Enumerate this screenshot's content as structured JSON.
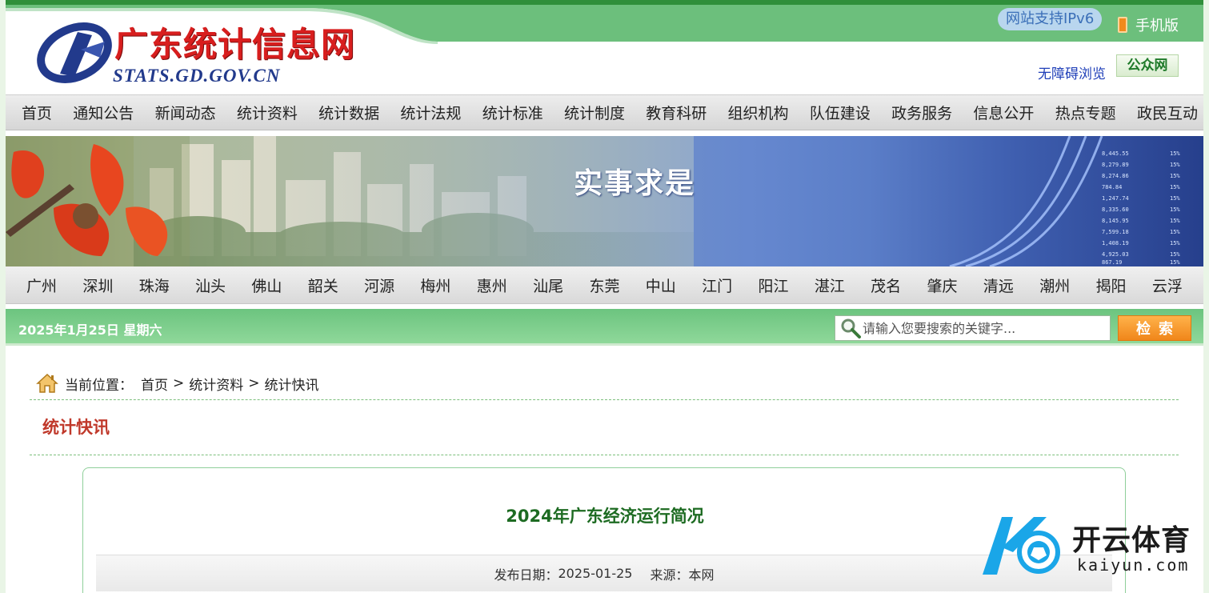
{
  "header": {
    "site_title": "广东统计信息网",
    "site_domain": "STATS.GD.GOV.CN",
    "ipv6_label": "网站支持IPv6",
    "mobile_label": "手机版",
    "accessible_label": "无障碍浏览",
    "public_net_label": "公众网"
  },
  "main_nav": [
    {
      "label": "首页"
    },
    {
      "label": "通知公告"
    },
    {
      "label": "新闻动态"
    },
    {
      "label": "统计资料"
    },
    {
      "label": "统计数据"
    },
    {
      "label": "统计法规"
    },
    {
      "label": "统计标准"
    },
    {
      "label": "统计制度"
    },
    {
      "label": "教育科研"
    },
    {
      "label": "组织机构"
    },
    {
      "label": "队伍建设"
    },
    {
      "label": "政务服务"
    },
    {
      "label": "信息公开"
    },
    {
      "label": "热点专题"
    },
    {
      "label": "政民互动"
    }
  ],
  "banner": {
    "slogan": "实事求是",
    "chart_numbers": [
      "8,445.55",
      "8,279.89",
      "8,274.86",
      "784.84",
      "1,247.74",
      "8,335.60",
      "8,145.95",
      "7,599.18",
      "1,408.19",
      "4,925.03",
      "867.19"
    ],
    "chart_percents": [
      "15%",
      "15%",
      "15%",
      "15%",
      "15%",
      "15%",
      "15%",
      "15%",
      "15%",
      "15%",
      "15%"
    ]
  },
  "city_nav": [
    {
      "label": "广州"
    },
    {
      "label": "深圳"
    },
    {
      "label": "珠海"
    },
    {
      "label": "汕头"
    },
    {
      "label": "佛山"
    },
    {
      "label": "韶关"
    },
    {
      "label": "河源"
    },
    {
      "label": "梅州"
    },
    {
      "label": "惠州"
    },
    {
      "label": "汕尾"
    },
    {
      "label": "东莞"
    },
    {
      "label": "中山"
    },
    {
      "label": "江门"
    },
    {
      "label": "阳江"
    },
    {
      "label": "湛江"
    },
    {
      "label": "茂名"
    },
    {
      "label": "肇庆"
    },
    {
      "label": "清远"
    },
    {
      "label": "潮州"
    },
    {
      "label": "揭阳"
    },
    {
      "label": "云浮"
    }
  ],
  "search": {
    "date_text": "2025年1月25日  星期六",
    "placeholder": "请输入您要搜索的关键字...",
    "value": "",
    "button_label": "检索"
  },
  "breadcrumb": {
    "label": "当前位置：",
    "items": [
      "首页",
      "统计资料",
      "统计快讯"
    ],
    "separator": ">"
  },
  "section": {
    "title": "统计快讯"
  },
  "article": {
    "title": "2024年广东经济运行简况",
    "date_label": "发布日期：",
    "date_value": "2025-01-25",
    "source_label": "来源：",
    "source_value": "本网"
  },
  "watermark": {
    "name": "开云体育",
    "url": "kaiyun.com"
  },
  "colors": {
    "accent_green": "#2f8f3a",
    "search_bar_green": "#6cc47f",
    "title_red": "#c0392b",
    "article_title_green": "#1d6b22",
    "button_orange": "#f0861a"
  },
  "icons": {
    "mobile": "phone-icon",
    "search": "search-icon",
    "home": "home-icon"
  }
}
